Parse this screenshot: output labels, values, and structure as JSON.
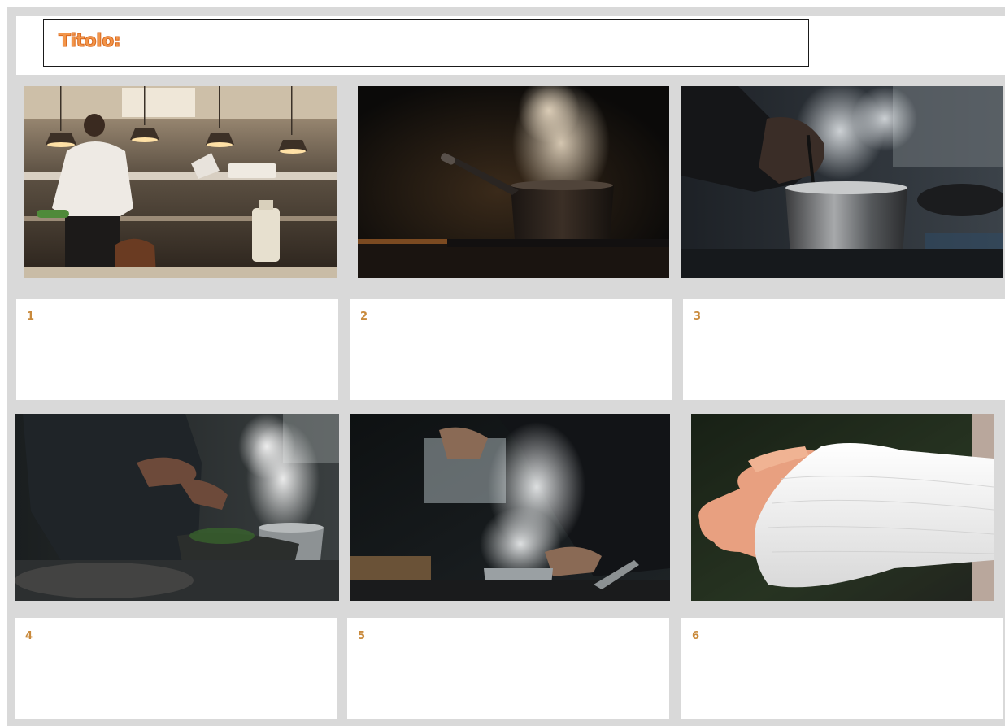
{
  "header": {
    "title_label": "Titolo:"
  },
  "photos": [
    {
      "icon": "restaurant-kitchen-chef-photo"
    },
    {
      "icon": "steaming-saucepan-photo"
    },
    {
      "icon": "stirring-steaming-pot-photo"
    },
    {
      "icon": "chef-cooking-steam-photo"
    },
    {
      "icon": "chef-steaming-pot-photo"
    },
    {
      "icon": "bandaged-arm-photo"
    }
  ],
  "panels": [
    {
      "number": "1",
      "text": ""
    },
    {
      "number": "2",
      "text": ""
    },
    {
      "number": "3",
      "text": ""
    },
    {
      "number": "4",
      "text": ""
    },
    {
      "number": "5",
      "text": ""
    },
    {
      "number": "6",
      "text": ""
    }
  ],
  "colors": {
    "accent": "#f2954a",
    "panel_number": "#c98a3c",
    "background": "#d9d9d9"
  }
}
